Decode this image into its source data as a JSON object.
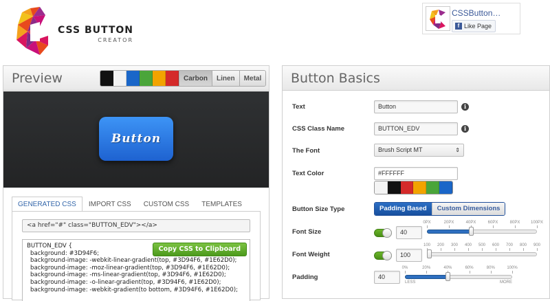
{
  "logo": {
    "title": "CSS BUTTON",
    "subtitle": "CREATOR"
  },
  "facebook": {
    "page_name": "CSSButton…",
    "like_label": "Like Page",
    "icon_letter": "f"
  },
  "preview": {
    "title": "Preview",
    "swatch_colors": [
      "#111111",
      "#f2f2f2",
      "#1a66c8",
      "#4aa53a",
      "#f2a300",
      "#d42a2a"
    ],
    "themes": [
      {
        "label": "Carbon",
        "active": true
      },
      {
        "label": "Linen",
        "active": false
      },
      {
        "label": "Metal",
        "active": false
      }
    ],
    "button_text": "Button",
    "tabs": [
      {
        "label": "GENERATED CSS",
        "active": true
      },
      {
        "label": "IMPORT CSS",
        "active": false
      },
      {
        "label": "CUSTOM CSS",
        "active": false
      },
      {
        "label": "TEMPLATES",
        "active": false
      }
    ],
    "html_snippet": "<a href=\"#\" class=\"BUTTON_EDV\"></a>",
    "copy_label": "Copy CSS to Clipboard",
    "css_lines": [
      "BUTTON_EDV {",
      "background: #3D94F6;",
      "background-image: -webkit-linear-gradient(top, #3D94F6, #1E62D0);",
      "background-image: -moz-linear-gradient(top, #3D94F6, #1E62D0);",
      "background-image: -ms-linear-gradient(top, #3D94F6, #1E62D0);",
      "background-image: -o-linear-gradient(top, #3D94F6, #1E62D0);",
      "background-image: -webkit-gradient(to bottom, #3D94F6, #1E62D0);"
    ]
  },
  "basics": {
    "title": "Button Basics",
    "text_label": "Text",
    "text_value": "Button",
    "class_label": "CSS Class Name",
    "class_value": "BUTTON_EDV",
    "font_label": "The Font",
    "font_value": "Brush Script MT",
    "color_label": "Text Color",
    "color_value": "#FFFFFF",
    "color_swatches": [
      "#f4f4f4",
      "#111111",
      "#d42a2a",
      "#f2a300",
      "#4aa53a",
      "#1a66c8"
    ],
    "size_type_label": "Button Size Type",
    "size_type_options": [
      {
        "label": "Padding Based",
        "active": true
      },
      {
        "label": "Custom Dimensions",
        "active": false
      }
    ],
    "font_size_label": "Font Size",
    "font_size_value": "40",
    "font_size_ticks": [
      "0PX",
      "20PX",
      "40PX",
      "60PX",
      "80PX",
      "100PX"
    ],
    "font_size_fraction": 0.4,
    "font_weight_label": "Font Weight",
    "font_weight_value": "100",
    "font_weight_ticks": [
      "100",
      "200",
      "300",
      "400",
      "500",
      "600",
      "700",
      "800",
      "900"
    ],
    "font_weight_fraction": 0.0,
    "padding_label": "Padding",
    "padding_value": "40",
    "padding_ticks": [
      "0%",
      "20%",
      "40%",
      "60%",
      "80%",
      "100%"
    ],
    "padding_less": "LESS",
    "padding_more": "MORE",
    "padding_fraction": 0.4
  }
}
